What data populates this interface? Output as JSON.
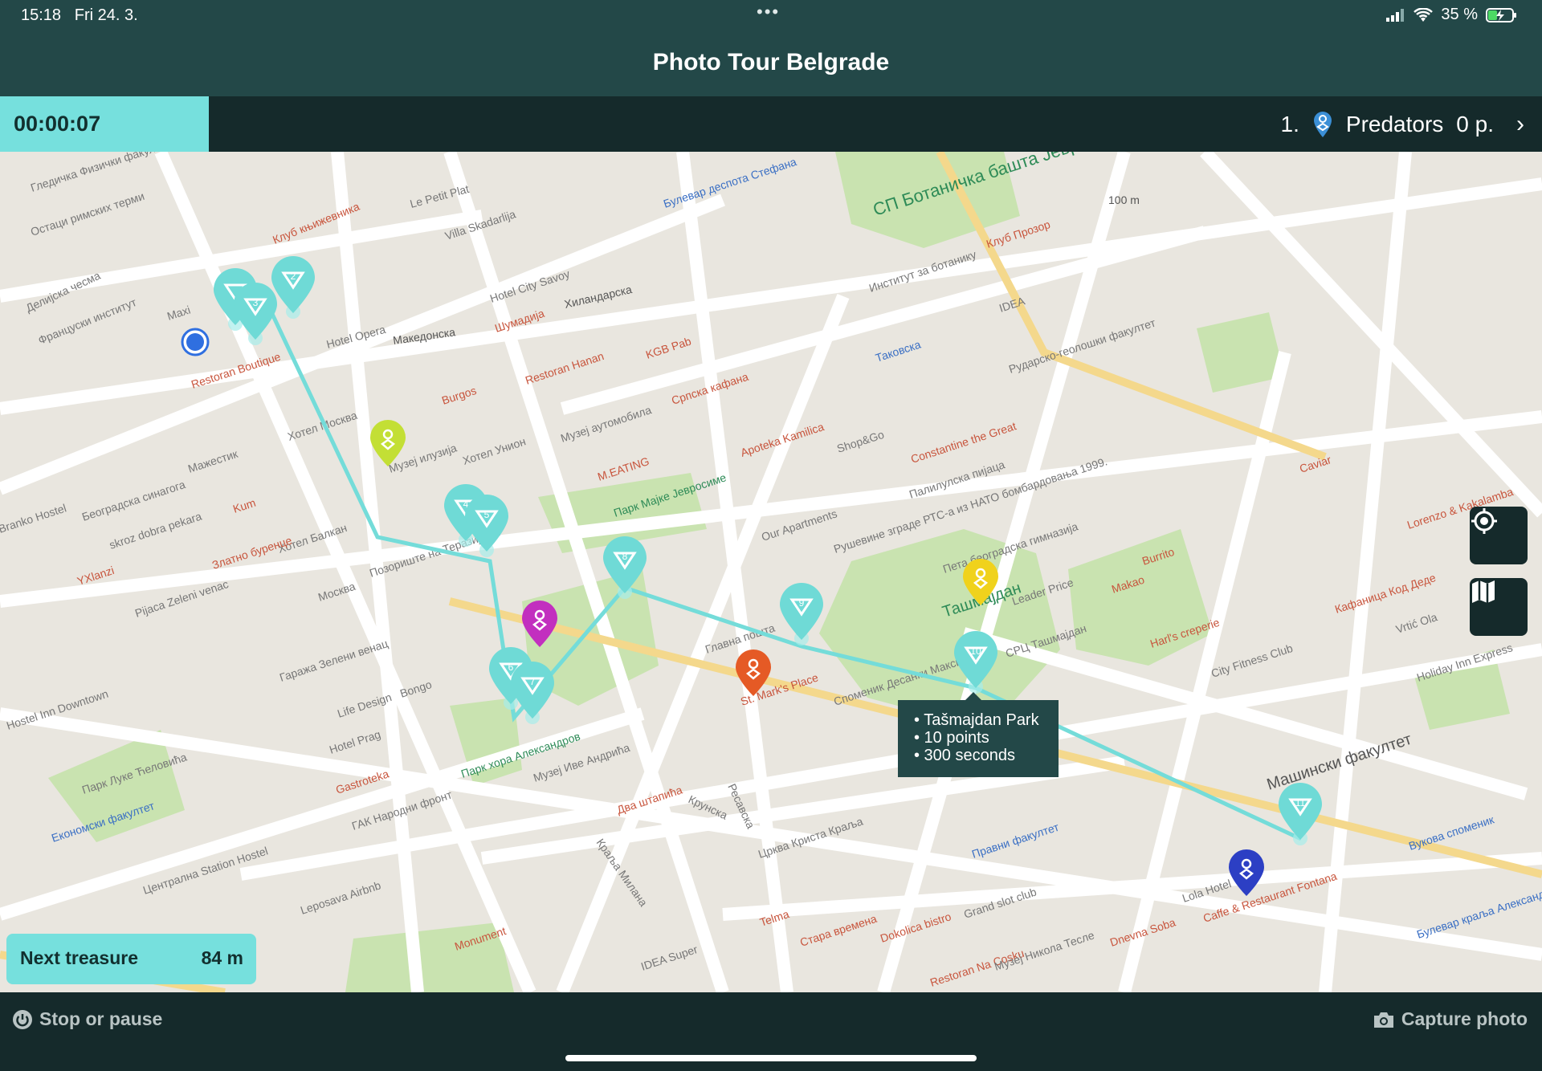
{
  "status": {
    "time": "15:18",
    "date": "Fri 24. 3.",
    "battery": "35 %",
    "dots": "•••"
  },
  "header": {
    "title": "Photo Tour Belgrade"
  },
  "timer": {
    "value": "00:00:07"
  },
  "team": {
    "rank": "1.",
    "name": "Predators",
    "points": "0 p.",
    "icon": "team-pin-icon",
    "chevron": "›"
  },
  "map": {
    "route_color": "#74dcd9",
    "treasure_color": "#6fdad6",
    "street_labels": [
      "Гледичка Физички факултет",
      "Остаци римских терми",
      "Делијска чесма",
      "Француски институт",
      "Restoran Boutique",
      "Hotel Opera",
      "Македонска",
      "Клуб књижевника",
      "Le Petit Plat",
      "Villa Skadarlija",
      "Hotel City Savoy",
      "Хиландарска",
      "Шумадија",
      "Restoran Hanan",
      "Burgos",
      "KGB Pab",
      "Српска кафана",
      "Музеј аутомобила",
      "M.EATING",
      "Парк Мајке Јевросиме",
      "Хотел Унион",
      "Музеј илузија",
      "Булевар деспота Стефана",
      "СП Ботаничка башта Јевремовац",
      "Институт за ботанику",
      "Таковска",
      "Клуб Прозор",
      "IDEA",
      "Рударско-геолошки факултет",
      "Apoteka Kamilica",
      "Shop&Go",
      "Constantine the Great",
      "Палилулска пијаца",
      "Our Apartments",
      "Рушевине зграде РТС-а из НАТО бомбардовања 1999.",
      "Пета београдска гимназија",
      "Leader Price",
      "Ташмајдан",
      "СРЦ Ташмајдан",
      "Главна пошта",
      "St. Mark's Place",
      "Споменик Десанки Максимовић",
      "Хотел Балкан",
      "Позориште на Теразијама",
      "Москва",
      "Гаража Зелени венац",
      "Bongo",
      "Life Design",
      "Hotel Prag",
      "Gastroteka",
      "ГАК Народни фронт",
      "Парк хора Александров",
      "Музеј Иве Андрића",
      "Два штапића",
      "Крунска",
      "Ресавска",
      "Краља Милана",
      "Црква Криста Краља",
      "Правни факултет",
      "Dnevna Soba",
      "Grand slot club",
      "Restoran Na Cosku",
      "Стара времена",
      "Dokolica bistro",
      "Telma",
      "Музеј Никола Тесле",
      "Lola Hotel",
      "Caffe & Restaurant Fontana",
      "Машински факултет",
      "City Fitness Club",
      "Harl's creperie",
      "Vrtić Ola",
      "Holiday Inn Express",
      "Кафаница Код Деде",
      "Lorenzo & Kakalamba",
      "Caviar",
      "Burrito",
      "Makao",
      "Централна Station Hostel",
      "Економски факултет",
      "Парк Луке Ћеловића",
      "Leposava Airbnb",
      "IDEA Super",
      "Monument",
      "Hostel Inn Downtown",
      "Branko Hostel",
      "Pijaca Zeleni venac",
      "Златно буренце",
      "YXlanzi",
      "Београдска синагога",
      "Kum",
      "skroz dobra pekara",
      "Мажестик",
      "Maxi",
      "Хотел Москва",
      "Вукова споменик",
      "Булевар краља Александра"
    ],
    "scale": "100 m"
  },
  "tooltip": {
    "line1": "• Tašmajdan Park",
    "line2": "• 10 points",
    "line3": "• 300 seconds"
  },
  "next_treasure": {
    "label": "Next treasure",
    "distance": "84 m"
  },
  "controls": {
    "locate": "crosshair-icon",
    "map": "map-icon"
  },
  "footer": {
    "stop": "Stop or pause",
    "capture": "Capture photo"
  },
  "treasures": [
    "1",
    "2",
    "3",
    "4",
    "5",
    "6",
    "7",
    "8",
    "9",
    "10",
    "11"
  ]
}
